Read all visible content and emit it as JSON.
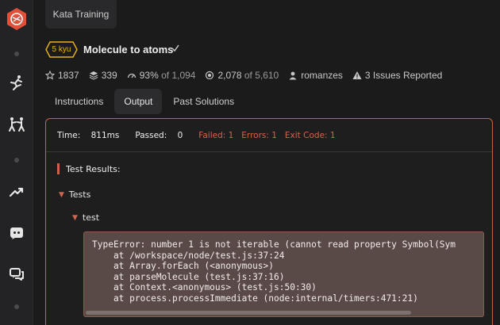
{
  "app": {
    "top_tab": "Kata Training"
  },
  "kata": {
    "rank": "5 kyu",
    "title": "Molecule to atoms"
  },
  "stats": {
    "stars": "1837",
    "collections": "339",
    "satisfaction_pct": "93%",
    "satisfaction_of": "of 1,094",
    "completed": "2,078",
    "completed_of": "of 5,610",
    "author": "romanzes",
    "issues": "3 Issues Reported"
  },
  "tabs": [
    {
      "label": "Instructions"
    },
    {
      "label": "Output"
    },
    {
      "label": "Past Solutions"
    }
  ],
  "summary": {
    "time_label": "Time:",
    "time_value": "811ms",
    "passed_label": "Passed:",
    "passed_value": "0",
    "failed": "Failed: 1",
    "errors": "Errors: 1",
    "exit_code": "Exit Code: 1"
  },
  "results": {
    "heading": "Test Results:",
    "group": "Tests",
    "test": "test",
    "error_text": "TypeError: number 1 is not iterable (cannot read property Symbol(Sym\n    at /workspace/node/test.js:37:24\n    at Array.forEach (<anonymous>)\n    at parseMolecule (test.js:37:16)\n    at Context.<anonymous> (test.js:50:30)\n    at process.processImmediate (node:internal/timers:471:21)"
  },
  "colors": {
    "accent": "#c8634a",
    "rank_yellow": "#ecb613",
    "logo_red": "#e0503b"
  },
  "icons": {
    "sidebar": [
      "codewars-logo-icon",
      "practice-icon",
      "sparring-icon",
      "leaderboards-icon",
      "discord-icon",
      "discussion-icon"
    ]
  }
}
